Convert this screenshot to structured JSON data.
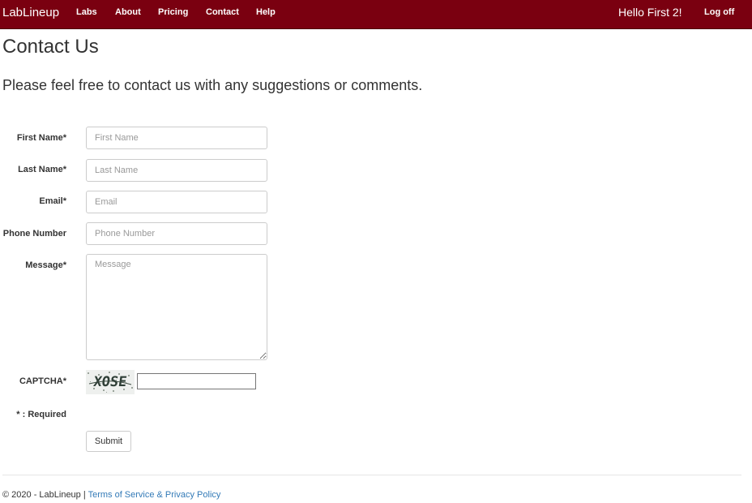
{
  "navbar": {
    "brand": "LabLineup",
    "links": [
      "Labs",
      "About",
      "Pricing",
      "Contact",
      "Help"
    ],
    "greeting": "Hello First 2!",
    "logoff": "Log off"
  },
  "page": {
    "title": "Contact Us",
    "subtitle": "Please feel free to contact us with any suggestions or comments."
  },
  "form": {
    "first_name": {
      "label": "First Name*",
      "placeholder": "First Name",
      "value": ""
    },
    "last_name": {
      "label": "Last Name*",
      "placeholder": "Last Name",
      "value": ""
    },
    "email": {
      "label": "Email*",
      "placeholder": "Email",
      "value": ""
    },
    "phone": {
      "label": "Phone Number",
      "placeholder": "Phone Number",
      "value": ""
    },
    "message": {
      "label": "Message*",
      "placeholder": "Message",
      "value": ""
    },
    "captcha": {
      "label": "CAPTCHA*",
      "image_text": "XOSE",
      "value": ""
    },
    "required_note": "* : Required",
    "submit_label": "Submit"
  },
  "footer": {
    "copyright": "© 2020 - LabLineup",
    "separator": "|",
    "link": "Terms of Service & Privacy Policy"
  },
  "colors": {
    "navbar": "#7a0010",
    "link": "#337ab7"
  }
}
